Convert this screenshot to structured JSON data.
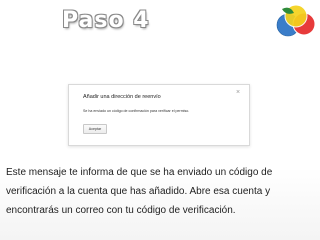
{
  "slide": {
    "title": "Paso 4",
    "description": "Este mensaje te informa de que se ha enviado un código de verificación a la cuenta que has añadido. Abre esa cuenta y encontrarás un correo con tu código de verificación."
  },
  "dialog": {
    "title": "Añadir una dirección de reenvío",
    "close_label": "×",
    "message": "Se ha enviado un código de confirmación para verificar el permiso.",
    "accept_label": "Aceptar"
  },
  "logo": {
    "icon": "colorful-circles-logo",
    "colors": [
      "#3a7dc9",
      "#e73b3b",
      "#f5d21c",
      "#2e8b3a"
    ]
  }
}
